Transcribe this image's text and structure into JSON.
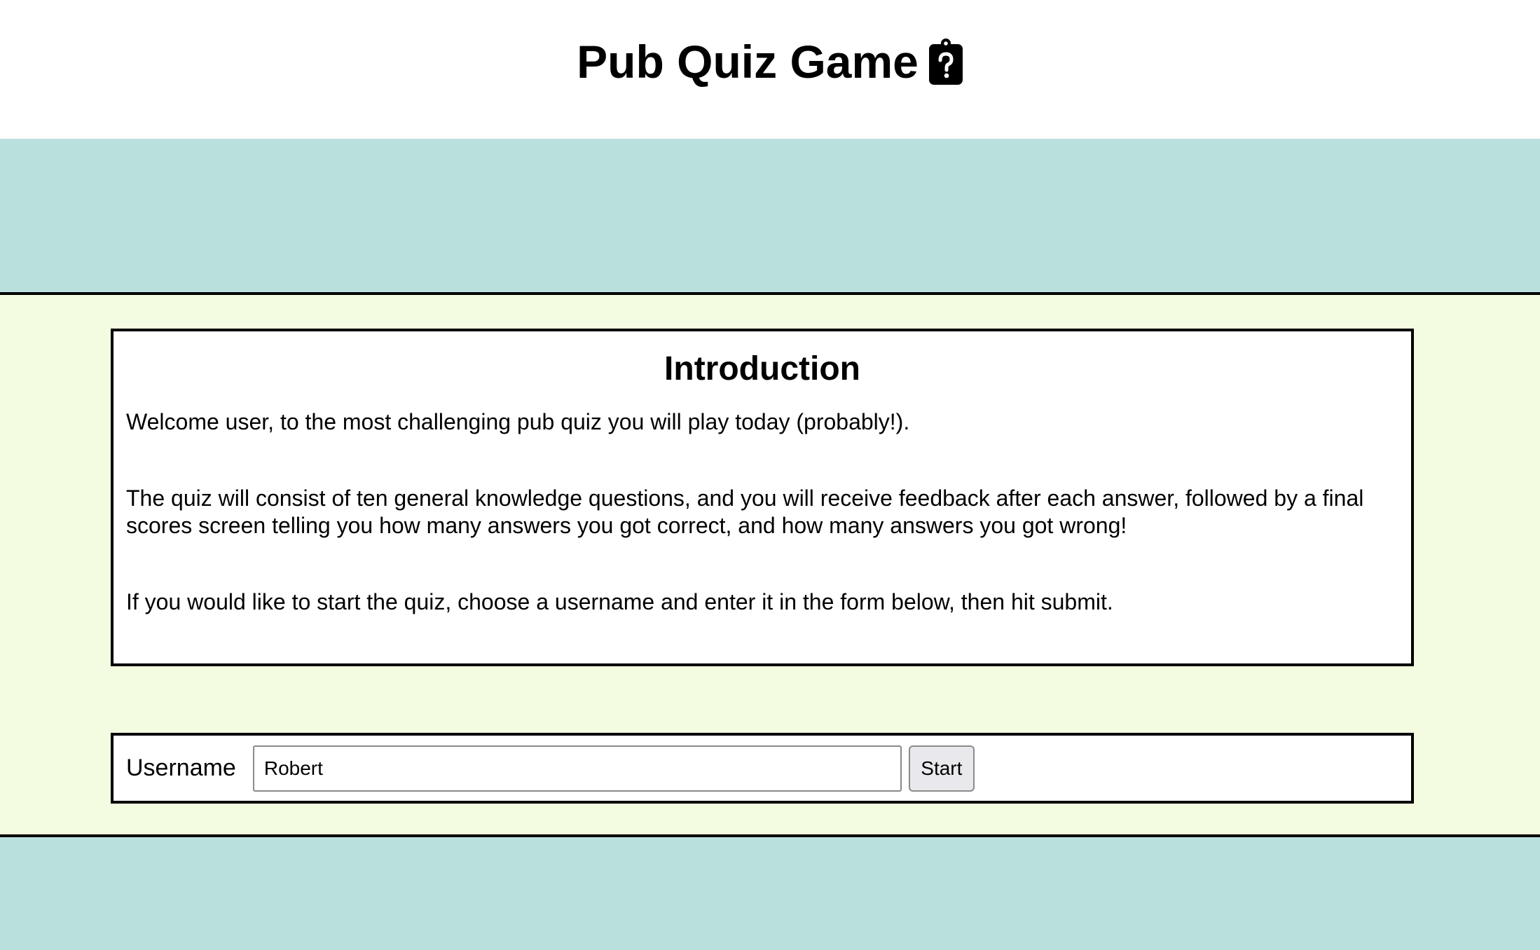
{
  "header": {
    "title": "Pub Quiz Game",
    "icon": "clipboard-question-icon"
  },
  "intro": {
    "heading": "Introduction",
    "paragraphs": [
      "Welcome user, to the most challenging pub quiz you will play today (probably!).",
      "The quiz will consist of ten general knowledge questions, and you will receive feedback after each answer, followed by a final scores screen telling you how many answers you got correct, and how many answers you got wrong!",
      "If you would like to start the quiz, choose a username and enter it in the form below, then hit submit."
    ]
  },
  "form": {
    "username_label": "Username",
    "username_value": "Robert",
    "start_label": "Start"
  },
  "colors": {
    "band": "#bae0de",
    "main_background": "#f3fce0",
    "border": "#000000"
  }
}
